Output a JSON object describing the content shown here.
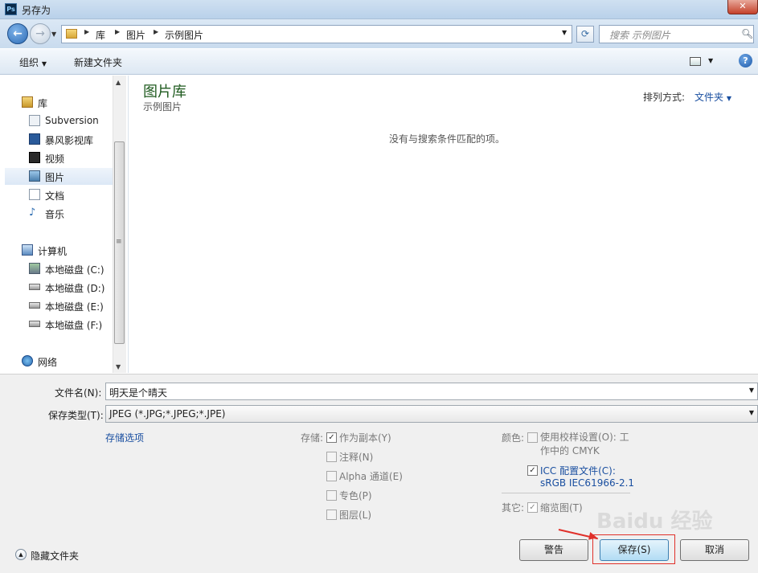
{
  "window": {
    "title": "另存为",
    "app_icon": "Ps"
  },
  "address": {
    "crumbs": [
      "库",
      "图片",
      "示例图片"
    ],
    "search_placeholder": "搜索 示例图片"
  },
  "toolbar": {
    "organize": "组织",
    "new_folder": "新建文件夹"
  },
  "nav": {
    "libraries": "库",
    "lib_items": [
      "Subversion",
      "暴风影视库",
      "视频",
      "图片",
      "文档",
      "音乐"
    ],
    "selected": "图片",
    "computer": "计算机",
    "drives": [
      "本地磁盘 (C:)",
      "本地磁盘 (D:)",
      "本地磁盘 (E:)",
      "本地磁盘 (F:)"
    ],
    "network": "网络"
  },
  "content": {
    "title": "图片库",
    "subtitle": "示例图片",
    "sort_label": "排列方式:",
    "sort_value": "文件夹",
    "empty_message": "没有与搜索条件匹配的项。"
  },
  "save": {
    "filename_label": "文件名(N):",
    "filename_value": "明天是个晴天",
    "type_label": "保存类型(T):",
    "type_value": "JPEG (*.JPG;*.JPEG;*.JPE)",
    "storage_options_link": "存储选项",
    "storage_label": "存储:",
    "storage_options": [
      {
        "label": "作为副本(Y)",
        "checked": true,
        "enabled": false
      },
      {
        "label": "注释(N)",
        "checked": false,
        "enabled": false
      },
      {
        "label": "Alpha 通道(E)",
        "checked": false,
        "enabled": false
      },
      {
        "label": "专色(P)",
        "checked": false,
        "enabled": false
      },
      {
        "label": "图层(L)",
        "checked": false,
        "enabled": false
      }
    ],
    "color_label": "颜色:",
    "proof_setup_label": "使用校样设置(O): 工作中的 CMYK",
    "icc_label": "ICC 配置文件(C):",
    "icc_value": "sRGB IEC61966-2.1",
    "other_label": "其它:",
    "thumbnail_label": "缩览图(T)"
  },
  "footer": {
    "hide_folders": "隐藏文件夹",
    "warning_button": "警告",
    "save_button": "保存(S)",
    "cancel_button": "取消"
  },
  "watermark": "Baidu 经验",
  "colors": {
    "accent": "#1a4fa0",
    "annotation_red": "#e0302a"
  }
}
